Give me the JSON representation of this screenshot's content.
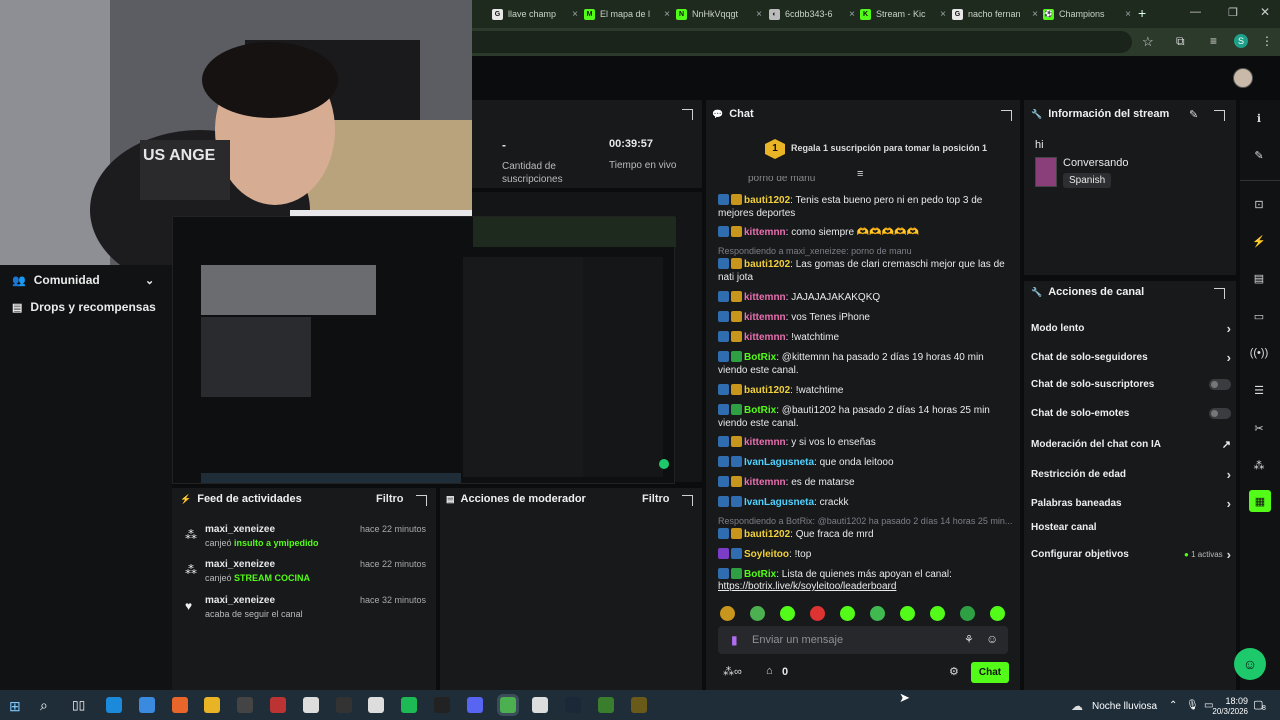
{
  "browser": {
    "tabs": [
      {
        "label": "llave champ",
        "fav": "G",
        "color": "#e8e8e8"
      },
      {
        "label": "El mapa de l",
        "fav": "M",
        "color": "#53fc18"
      },
      {
        "label": "NnHkVqqgt",
        "fav": "N",
        "color": "#53fc18"
      },
      {
        "label": "6cdbb343-6",
        "fav": "◐",
        "color": "#bbbbbb"
      },
      {
        "label": "Stream - Kic",
        "fav": "K",
        "color": "#53fc18"
      },
      {
        "label": "nacho fernan",
        "fav": "G",
        "color": "#e8e8e8"
      },
      {
        "label": "Champions",
        "fav": "⚽",
        "color": "#53fc18"
      }
    ],
    "new_tab": "+",
    "profile_initial": "S"
  },
  "nav": {
    "items": [
      {
        "label": "Comunidad",
        "icon": "people-icon"
      },
      {
        "label": "Drops y recompensas",
        "icon": "gift-icon"
      }
    ]
  },
  "stats": {
    "subs_value": "-",
    "subs_label": "Cantidad de suscripciones",
    "live_value": "00:39:57",
    "live_label": "Tiempo en vivo"
  },
  "feed": {
    "title": "Feed de actividades",
    "filter": "Filtro",
    "items": [
      {
        "user": "maxi_xeneizee",
        "action": "canjeó",
        "reward": "insulto a ymipedido",
        "time": "hace 22 minutos"
      },
      {
        "user": "maxi_xeneizee",
        "action": "canjeó",
        "reward": "STREAM COCINA",
        "time": "hace 22 minutos"
      },
      {
        "user": "maxi_xeneizee",
        "action": "acaba de seguir el canal",
        "reward": "",
        "time": "hace 32 minutos"
      }
    ]
  },
  "mod": {
    "title": "Acciones de moderador",
    "filter": "Filtro"
  },
  "chat": {
    "title": "Chat",
    "pin_number": "1",
    "pin_text": "Regala 1 suscripción para tomar la posición 1",
    "messages": [
      {
        "user": "bauti1202",
        "text": "Tenis esta bueno pero ni en pedo top 3 de mejores deportes",
        "color": "#f0d03a",
        "badges": [
          "b1",
          "b2"
        ]
      },
      {
        "user": "kittemnn",
        "text": "como siempre 🫶🫶🫶🫶🫶",
        "color": "#e86fb0",
        "badges": [
          "b1",
          "b2"
        ]
      },
      {
        "user": "bauti1202",
        "text": "Las gomas de clari cremaschi mejor que las de nati jota",
        "color": "#f0d03a",
        "badges": [
          "b1",
          "b2"
        ]
      },
      {
        "user": "kittemnn",
        "text": "JAJAJAJAKAKQKQ",
        "color": "#e86fb0",
        "badges": [
          "b1",
          "b2"
        ]
      },
      {
        "user": "kittemnn",
        "text": "vos Tenes iPhone",
        "color": "#e86fb0",
        "badges": [
          "b1",
          "b2"
        ]
      },
      {
        "user": "kittemnn",
        "text": "!watchtime",
        "color": "#e86fb0",
        "badges": [
          "b1",
          "b2"
        ]
      },
      {
        "user": "BotRix",
        "text": "@kittemnn ha pasado 2 días 19 horas 40 min viendo este canal.",
        "color": "#53fc18",
        "badges": [
          "b1",
          "b3"
        ]
      },
      {
        "user": "bauti1202",
        "text": "!watchtime",
        "color": "#f0d03a",
        "badges": [
          "b1",
          "b2"
        ]
      },
      {
        "user": "BotRix",
        "text": "@bauti1202 ha pasado 2 días 14 horas 25 min viendo este canal.",
        "color": "#53fc18",
        "badges": [
          "b1",
          "b3"
        ]
      },
      {
        "user": "kittemnn",
        "text": "y si vos lo enseñas",
        "color": "#e86fb0",
        "badges": [
          "b1",
          "b2"
        ]
      },
      {
        "user": "IvanLagusneta",
        "text": "que onda leitooo",
        "color": "#4fd1ff",
        "badges": [
          "b1",
          "b1"
        ]
      },
      {
        "user": "kittemnn",
        "text": "es de matarse",
        "color": "#e86fb0",
        "badges": [
          "b1",
          "b2"
        ]
      },
      {
        "user": "IvanLagusneta",
        "text": "crackk",
        "color": "#4fd1ff",
        "badges": [
          "b1",
          "b1"
        ]
      },
      {
        "user": "bauti1202",
        "text": "Que fraca de mrd",
        "color": "#f0d03a",
        "badges": [
          "b1",
          "b2"
        ]
      },
      {
        "user": "Soyleitoo",
        "text": "!top",
        "color": "#f0d03a",
        "badges": [
          "b4",
          "b1"
        ]
      },
      {
        "user": "BotRix",
        "text": "Lista de quienes más apoyan el canal:",
        "color": "#53fc18",
        "badges": [
          "b1",
          "b3"
        ]
      }
    ],
    "partial_top": "porno de manu",
    "reply1": "Respondiendo a maxi_xeneizee: porno de manu",
    "reply2": "Respondiendo a BotRix: @bauti1202 ha pasado 2 días 14 horas 25 min...",
    "link": "https://botrix.live/k/soyleitoo/leaderboard",
    "placeholder": "Enviar un mensaje",
    "points": "0",
    "send": "Chat"
  },
  "info": {
    "title": "Información del stream",
    "stream_title": "hi",
    "category": "Conversando",
    "language": "Spanish"
  },
  "actions": {
    "title": "Acciones de canal",
    "items": [
      {
        "label": "Modo lento",
        "kind": "chevron"
      },
      {
        "label": "Chat de solo-seguidores",
        "kind": "chevron"
      },
      {
        "label": "Chat de solo-suscriptores",
        "kind": "toggle"
      },
      {
        "label": "Chat de solo-emotes",
        "kind": "toggle"
      },
      {
        "label": "Moderación del chat con IA",
        "kind": "external"
      },
      {
        "label": "Restricción de edad",
        "kind": "chevron"
      },
      {
        "label": "Palabras baneadas",
        "kind": "chevron"
      },
      {
        "label": "Hostear canal",
        "kind": "none"
      },
      {
        "label": "Configurar objetivos",
        "kind": "chevron",
        "extra": "1 activas"
      }
    ]
  },
  "taskbar": {
    "weather": "Noche lluviosa",
    "time": "18:09",
    "date": "20/3/2026",
    "notif": "8"
  },
  "colors": {
    "accent": "#53fc18",
    "panel": "#18191b",
    "bg": "#0b0c0d"
  }
}
